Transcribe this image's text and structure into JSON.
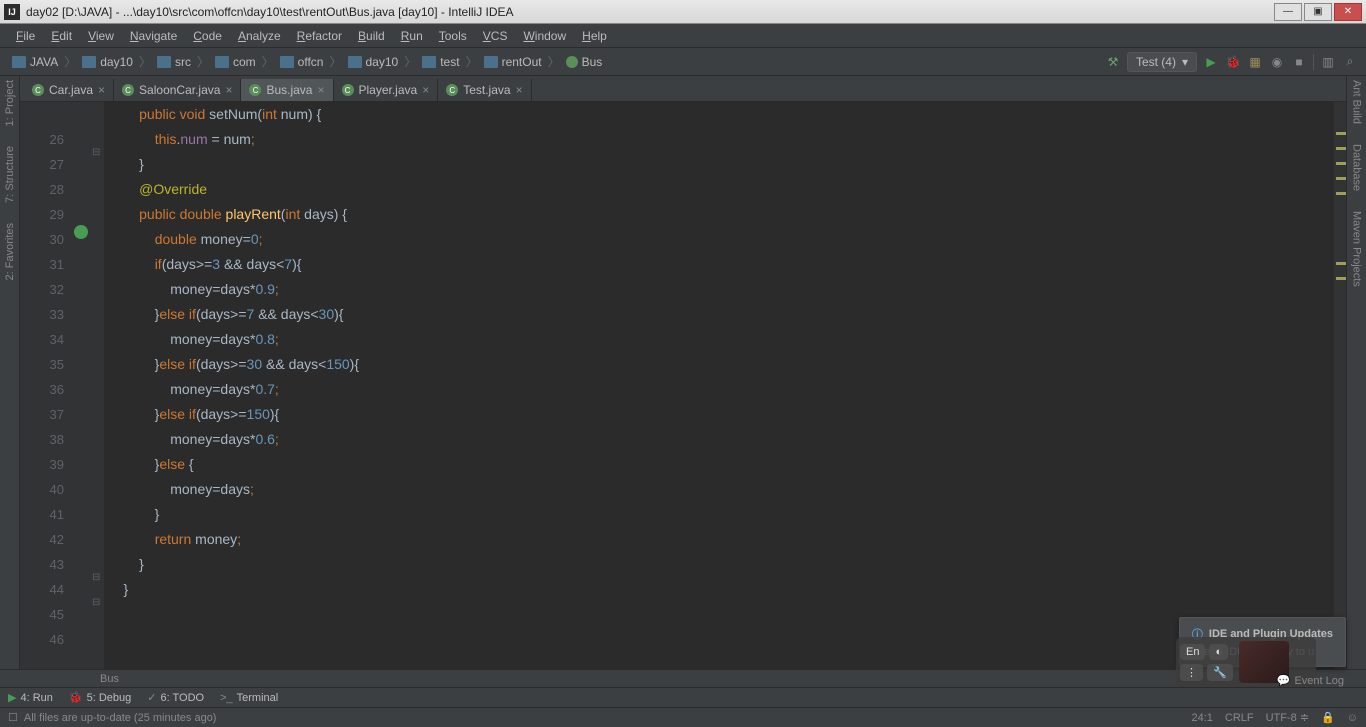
{
  "window": {
    "title": "day02 [D:\\JAVA] - ...\\day10\\src\\com\\offcn\\day10\\test\\rentOut\\Bus.java [day10] - IntelliJ IDEA"
  },
  "menu": [
    "File",
    "Edit",
    "View",
    "Navigate",
    "Code",
    "Analyze",
    "Refactor",
    "Build",
    "Run",
    "Tools",
    "VCS",
    "Window",
    "Help"
  ],
  "breadcrumbs": [
    "JAVA",
    "day10",
    "src",
    "com",
    "offcn",
    "day10",
    "test",
    "rentOut",
    "Bus"
  ],
  "run_config": "Test (4)",
  "tabs": [
    {
      "label": "Car.java",
      "active": false
    },
    {
      "label": "SaloonCar.java",
      "active": false
    },
    {
      "label": "Bus.java",
      "active": true
    },
    {
      "label": "Player.java",
      "active": false
    },
    {
      "label": "Test.java",
      "active": false
    }
  ],
  "gutter_lines": [
    "",
    "26",
    "27",
    "28",
    "29",
    "30",
    "31",
    "32",
    "33",
    "34",
    "35",
    "36",
    "37",
    "38",
    "39",
    "40",
    "41",
    "42",
    "43",
    "44",
    "45",
    "46"
  ],
  "code_lines": [
    {
      "indent": 8,
      "tokens": [
        {
          "t": "public void",
          "c": "k-orange"
        },
        {
          "t": " setNum",
          "c": ""
        },
        {
          "t": "(",
          "c": ""
        },
        {
          "t": "int",
          "c": "k-orange"
        },
        {
          "t": " num) {",
          "c": ""
        }
      ]
    },
    {
      "indent": 12,
      "tokens": [
        {
          "t": "this",
          "c": "k-orange"
        },
        {
          "t": ".",
          "c": ""
        },
        {
          "t": "num",
          "c": "k-purple"
        },
        {
          "t": " = num",
          "c": ""
        },
        {
          "t": ";",
          "c": "k-orange"
        }
      ]
    },
    {
      "indent": 8,
      "tokens": [
        {
          "t": "}",
          "c": ""
        }
      ]
    },
    {
      "indent": 0,
      "tokens": []
    },
    {
      "indent": 8,
      "tokens": [
        {
          "t": "@Override",
          "c": "k-olive"
        }
      ]
    },
    {
      "indent": 8,
      "tokens": [
        {
          "t": "public double",
          "c": "k-orange"
        },
        {
          "t": " ",
          "c": ""
        },
        {
          "t": "playRent",
          "c": "k-yellow"
        },
        {
          "t": "(",
          "c": ""
        },
        {
          "t": "int",
          "c": "k-orange"
        },
        {
          "t": " days) {",
          "c": ""
        }
      ]
    },
    {
      "indent": 12,
      "tokens": [
        {
          "t": "double",
          "c": "k-orange"
        },
        {
          "t": " money=",
          "c": ""
        },
        {
          "t": "0",
          "c": "k-blue"
        },
        {
          "t": ";",
          "c": "k-orange"
        }
      ]
    },
    {
      "indent": 12,
      "tokens": [
        {
          "t": "if",
          "c": "k-orange"
        },
        {
          "t": "(days>=",
          "c": ""
        },
        {
          "t": "3",
          "c": "k-blue"
        },
        {
          "t": " && days<",
          "c": ""
        },
        {
          "t": "7",
          "c": "k-blue"
        },
        {
          "t": "){",
          "c": ""
        }
      ]
    },
    {
      "indent": 16,
      "tokens": [
        {
          "t": "money=days*",
          "c": ""
        },
        {
          "t": "0.9",
          "c": "k-blue"
        },
        {
          "t": ";",
          "c": "k-orange"
        }
      ]
    },
    {
      "indent": 12,
      "tokens": [
        {
          "t": "}",
          "c": ""
        },
        {
          "t": "else if",
          "c": "k-orange"
        },
        {
          "t": "(days>=",
          "c": ""
        },
        {
          "t": "7",
          "c": "k-blue"
        },
        {
          "t": " && days<",
          "c": ""
        },
        {
          "t": "30",
          "c": "k-blue"
        },
        {
          "t": "){",
          "c": ""
        }
      ]
    },
    {
      "indent": 16,
      "tokens": [
        {
          "t": "money=days*",
          "c": ""
        },
        {
          "t": "0.8",
          "c": "k-blue"
        },
        {
          "t": ";",
          "c": "k-orange"
        }
      ]
    },
    {
      "indent": 12,
      "tokens": [
        {
          "t": "}",
          "c": ""
        },
        {
          "t": "else if",
          "c": "k-orange"
        },
        {
          "t": "(days>=",
          "c": ""
        },
        {
          "t": "30",
          "c": "k-blue"
        },
        {
          "t": " && days<",
          "c": ""
        },
        {
          "t": "150",
          "c": "k-blue"
        },
        {
          "t": "){",
          "c": ""
        }
      ]
    },
    {
      "indent": 16,
      "tokens": [
        {
          "t": "money=days*",
          "c": ""
        },
        {
          "t": "0.7",
          "c": "k-blue"
        },
        {
          "t": ";",
          "c": "k-orange"
        }
      ]
    },
    {
      "indent": 12,
      "tokens": [
        {
          "t": "}",
          "c": ""
        },
        {
          "t": "else if",
          "c": "k-orange"
        },
        {
          "t": "(days>=",
          "c": ""
        },
        {
          "t": "150",
          "c": "k-blue"
        },
        {
          "t": "){",
          "c": ""
        }
      ]
    },
    {
      "indent": 16,
      "tokens": [
        {
          "t": "money=days*",
          "c": ""
        },
        {
          "t": "0.6",
          "c": "k-blue"
        },
        {
          "t": ";",
          "c": "k-orange"
        }
      ]
    },
    {
      "indent": 12,
      "tokens": [
        {
          "t": "}",
          "c": ""
        },
        {
          "t": "else",
          "c": "k-orange"
        },
        {
          "t": " {",
          "c": ""
        }
      ]
    },
    {
      "indent": 16,
      "tokens": [
        {
          "t": "money=days",
          "c": ""
        },
        {
          "t": ";",
          "c": "k-orange"
        }
      ]
    },
    {
      "indent": 12,
      "tokens": [
        {
          "t": "}",
          "c": ""
        }
      ]
    },
    {
      "indent": 12,
      "tokens": [
        {
          "t": "return",
          "c": "k-orange"
        },
        {
          "t": " money",
          "c": ""
        },
        {
          "t": ";",
          "c": "k-orange"
        }
      ]
    },
    {
      "indent": 8,
      "tokens": [
        {
          "t": "}",
          "c": ""
        }
      ]
    },
    {
      "indent": 4,
      "tokens": [
        {
          "t": "}",
          "c": ""
        }
      ]
    },
    {
      "indent": 0,
      "tokens": []
    }
  ],
  "crumb_bottom": "Bus",
  "left_tools": [
    "1: Project",
    "7: Structure",
    "2: Favorites"
  ],
  "right_tools": [
    "Ant Build",
    "Database",
    "Maven Projects"
  ],
  "bottom_tools": [
    {
      "icon": "▶",
      "label": "4: Run",
      "color": "#499c54"
    },
    {
      "icon": "🐞",
      "label": "5: Debug",
      "color": "#5a8f5a"
    },
    {
      "icon": "✓",
      "label": "6: TODO",
      "color": "#888"
    },
    {
      "icon": ">_",
      "label": "Terminal",
      "color": "#888"
    }
  ],
  "notification": {
    "title": "IDE and Plugin Updates",
    "body_prefix": "IntelliJ IDEA is ready to ",
    "body_link": "u"
  },
  "ime": {
    "lang": "En"
  },
  "event_log_label": "Event Log",
  "status": {
    "message": "All files are up-to-date (25 minutes ago)",
    "pos": "24:1",
    "line_sep": "CRLF",
    "encoding": "UTF-8",
    "lock": "🔒"
  }
}
